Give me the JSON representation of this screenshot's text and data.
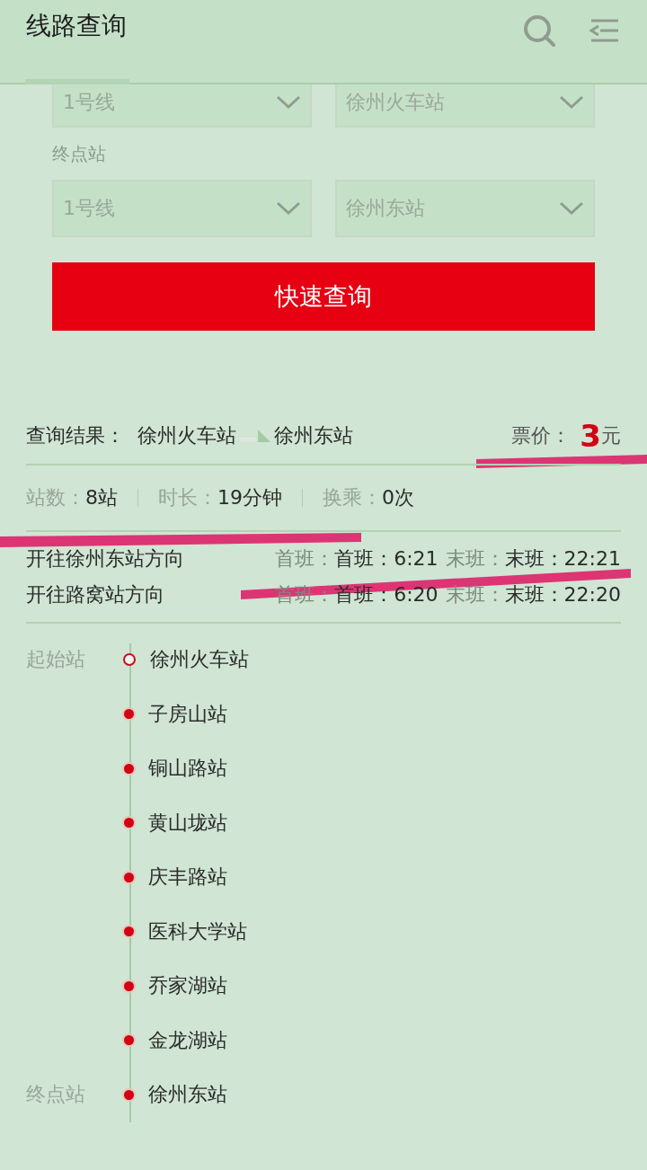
{
  "header": {
    "title": "线路查询",
    "tab_selected": true
  },
  "form": {
    "start": {
      "line": "1号线",
      "station": "徐州火车站"
    },
    "end_label": "终点站",
    "end": {
      "line": "1号线",
      "station": "徐州东站"
    },
    "button": "快速查询"
  },
  "result": {
    "label": "查询结果：",
    "from": "徐州火车站",
    "to": "徐州东站",
    "fare_label": "票价：",
    "fare": "3",
    "fare_unit": "元"
  },
  "stats": [
    {
      "label": "站数：",
      "value": "8站"
    },
    {
      "label": "时长：",
      "value": "19分钟"
    },
    {
      "label": "换乘：",
      "value": "0次"
    }
  ],
  "directions": [
    {
      "name": "开往徐州东站方向",
      "first_label": "首班：",
      "first": "首班：6:21",
      "last_label": "末班：",
      "last": "末班：22:21"
    },
    {
      "name": "开往路窝站方向",
      "first_label": "首班：",
      "first": "首班：6:20",
      "last_label": "末班：",
      "last": "末班：22:20"
    }
  ],
  "stations": [
    {
      "name": "徐州火车站",
      "tag": "起始站",
      "kind": "start"
    },
    {
      "name": "子房山站",
      "kind": "middle"
    },
    {
      "name": "铜山路站",
      "kind": "middle"
    },
    {
      "name": "黄山垅站",
      "kind": "middle"
    },
    {
      "name": "庆丰路站",
      "kind": "middle"
    },
    {
      "name": "医科大学站",
      "kind": "middle"
    },
    {
      "name": "乔家湖站",
      "kind": "middle"
    },
    {
      "name": "金龙湖站",
      "kind": "middle"
    },
    {
      "name": "徐州东站",
      "tag": "终点站",
      "kind": "end"
    }
  ]
}
